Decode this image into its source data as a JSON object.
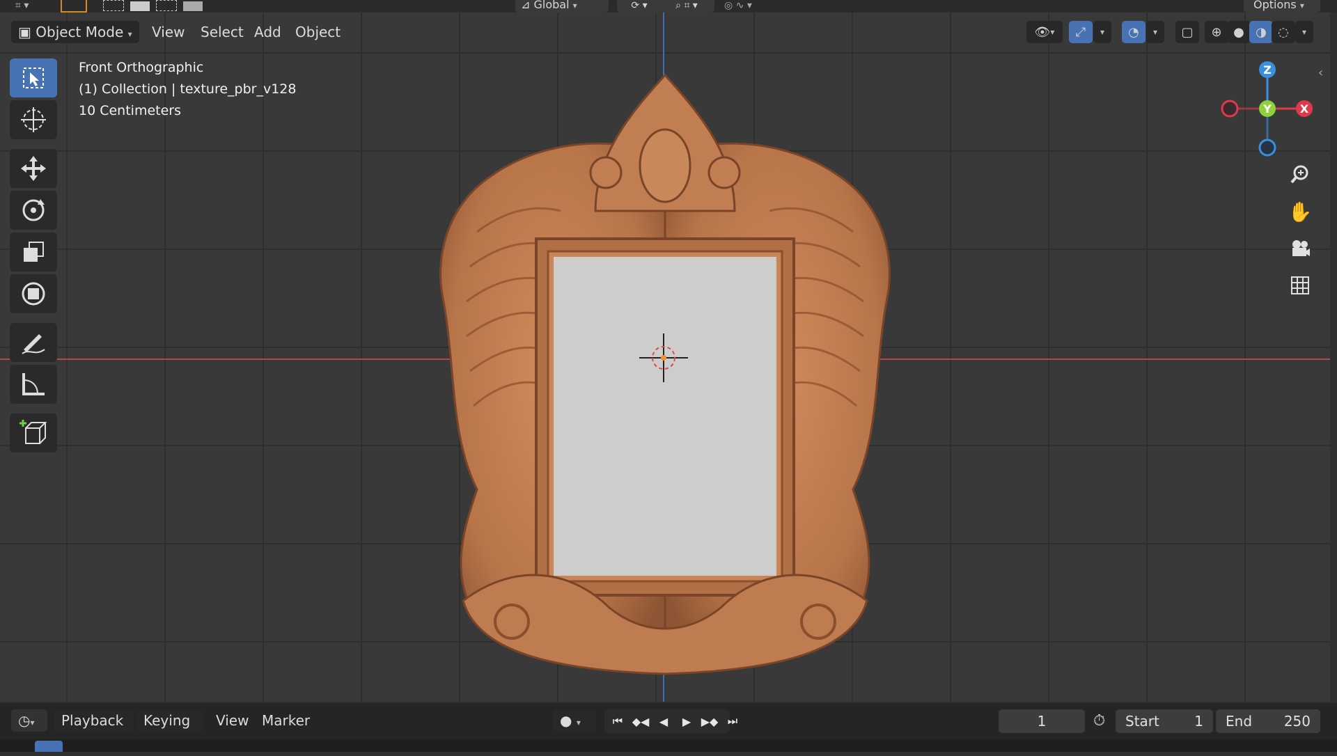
{
  "top_strip": {
    "orientation_label": "Global",
    "options_label": "Options"
  },
  "header": {
    "mode_label": "Object Mode",
    "menus": [
      "View",
      "Select",
      "Add",
      "Object"
    ]
  },
  "overlay_text": {
    "view_name": "Front Orthographic",
    "collection": "(1) Collection | texture_pbr_v128",
    "scale": "10 Centimeters"
  },
  "gizmo": {
    "z": "Z",
    "y": "Y",
    "x": "X"
  },
  "timeline": {
    "menus": [
      "Playback",
      "Keying",
      "View",
      "Marker"
    ],
    "current_frame": "1",
    "start_label": "Start",
    "start_value": "1",
    "end_label": "End",
    "end_value": "250"
  },
  "tools": [
    "select-box-icon",
    "cursor-icon",
    "move-icon",
    "rotate-icon",
    "scale-icon",
    "transform-icon",
    "annotate-icon",
    "measure-icon",
    "add-cube-icon"
  ],
  "colors": {
    "accent": "#4772b3",
    "x_axis": "#b5454e",
    "z_axis": "#3e6fb4",
    "frame_wood": "#b8754a",
    "gizmo_x": "#e0394b",
    "gizmo_y": "#8fd13b",
    "gizmo_z": "#3a8fde"
  }
}
